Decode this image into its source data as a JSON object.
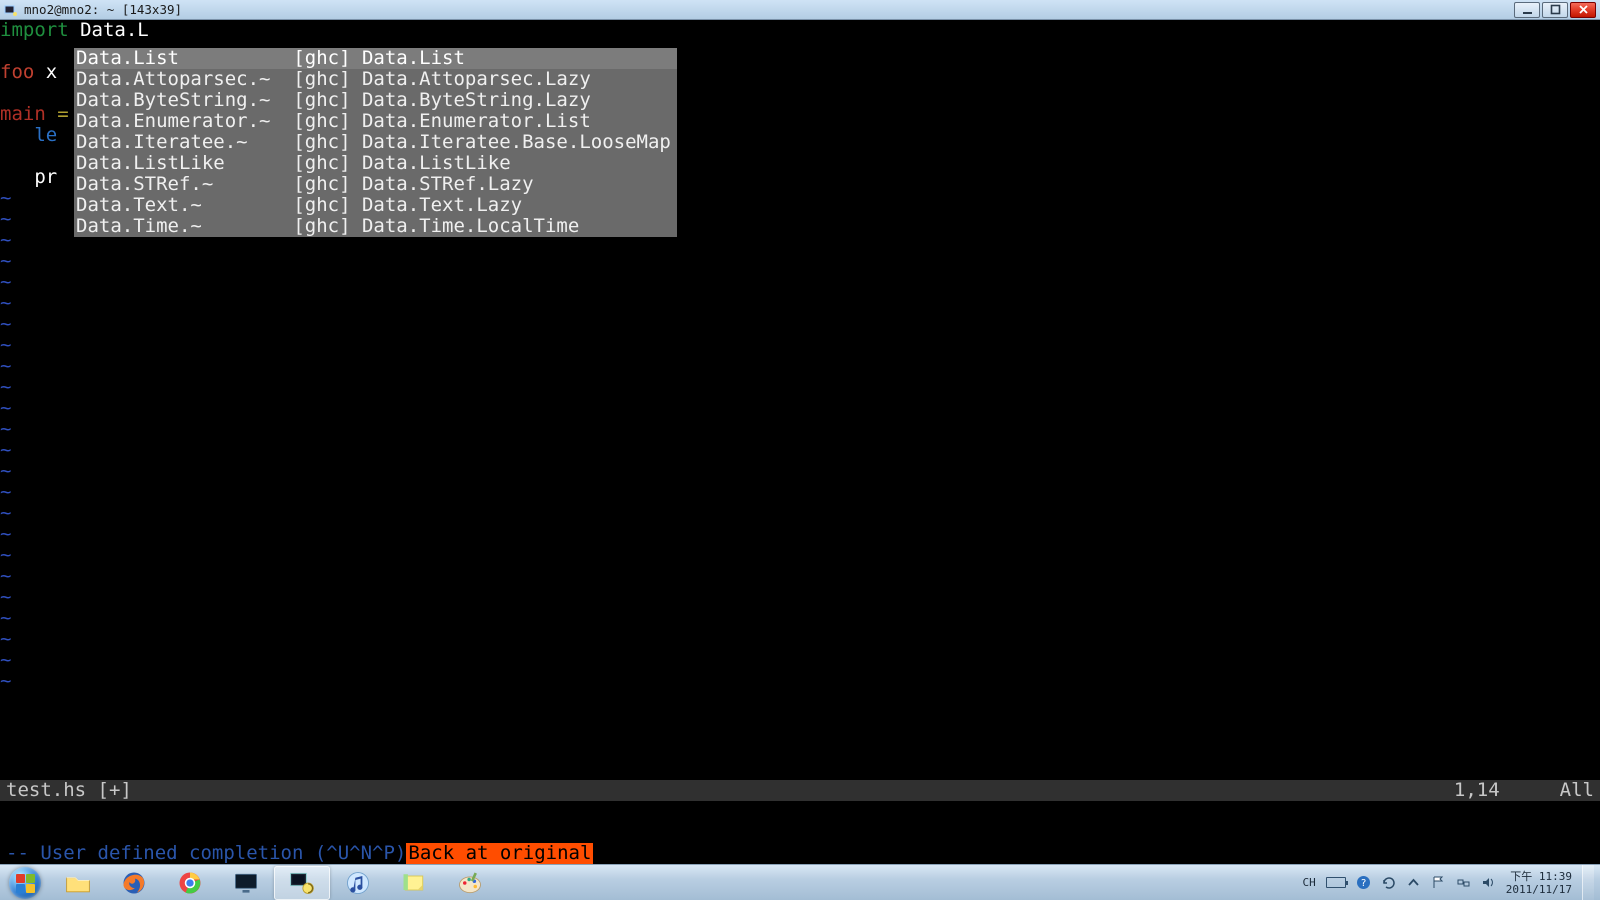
{
  "window": {
    "title": "mno2@mno2: ~ [143x39]"
  },
  "buffer": {
    "lines": [
      {
        "segments": [
          {
            "t": "import ",
            "c": "kw-import"
          },
          {
            "t": "Data.L",
            "c": "word-white"
          }
        ]
      },
      {
        "segments": []
      },
      {
        "segments": [
          {
            "t": "foo ",
            "c": "kw-foo"
          },
          {
            "t": "x",
            "c": "word-white"
          }
        ]
      },
      {
        "segments": []
      },
      {
        "segments": [
          {
            "t": "main ",
            "c": "kw-main"
          },
          {
            "t": "=",
            "c": "kw-eq"
          }
        ]
      },
      {
        "segments": [
          {
            "t": "   le",
            "c": "kw-let"
          }
        ]
      },
      {
        "segments": []
      },
      {
        "segments": [
          {
            "t": "   pr",
            "c": "word-white"
          }
        ]
      }
    ],
    "tilde_lines": 24
  },
  "popup": {
    "items": [
      {
        "abbr": "Data.List",
        "tag": "[ghc]",
        "full": "Data.List",
        "sel": true
      },
      {
        "abbr": "Data.Attoparsec.~",
        "tag": "[ghc]",
        "full": "Data.Attoparsec.Lazy"
      },
      {
        "abbr": "Data.ByteString.~",
        "tag": "[ghc]",
        "full": "Data.ByteString.Lazy"
      },
      {
        "abbr": "Data.Enumerator.~",
        "tag": "[ghc]",
        "full": "Data.Enumerator.List"
      },
      {
        "abbr": "Data.Iteratee.~",
        "tag": "[ghc]",
        "full": "Data.Iteratee.Base.LooseMap"
      },
      {
        "abbr": "Data.ListLike",
        "tag": "[ghc]",
        "full": "Data.ListLike"
      },
      {
        "abbr": "Data.STRef.~",
        "tag": "[ghc]",
        "full": "Data.STRef.Lazy"
      },
      {
        "abbr": "Data.Text.~",
        "tag": "[ghc]",
        "full": "Data.Text.Lazy"
      },
      {
        "abbr": "Data.Time.~",
        "tag": "[ghc]",
        "full": "Data.Time.LocalTime"
      }
    ]
  },
  "status": {
    "file": "test.hs [+]",
    "pos": "1,14",
    "scroll": "All"
  },
  "cmd": {
    "prefix": "-- User defined completion (^U^N^P) ",
    "hilite": "Back at original"
  },
  "tray": {
    "ime": "CH",
    "time": "下午 11:39",
    "date": "2011/11/17"
  }
}
